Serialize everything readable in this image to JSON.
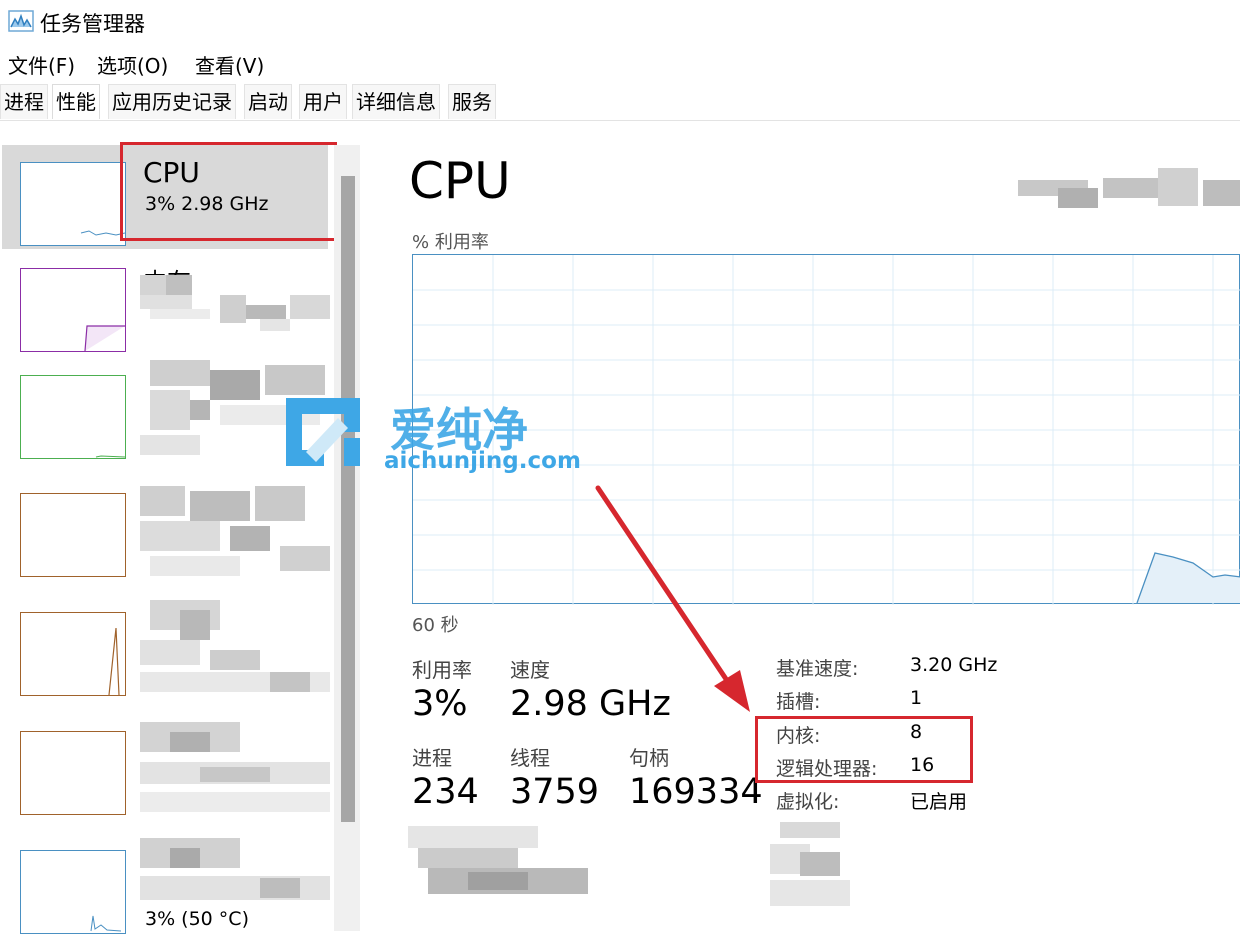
{
  "window": {
    "title": "任务管理器"
  },
  "menu": [
    "文件(F)",
    "选项(O)",
    "查看(V)"
  ],
  "tabs": [
    "进程",
    "性能",
    "应用历史记录",
    "启动",
    "用户",
    "详细信息",
    "服务"
  ],
  "sidebar": {
    "selected": {
      "title": "CPU",
      "subtitle": "3%  2.98 GHz"
    },
    "memory_title_partial": "内存",
    "last_item_subtitle": "3% (50 °C)"
  },
  "main": {
    "title": "CPU",
    "graph_top_label": "% 利用率",
    "graph_bottom_label": "60 秒",
    "stats": {
      "utilization_label": "利用率",
      "utilization_value": "3%",
      "speed_label": "速度",
      "speed_value": "2.98 GHz",
      "processes_label": "进程",
      "processes_value": "234",
      "threads_label": "线程",
      "threads_value": "3759",
      "handles_label": "句柄",
      "handles_value": "169334"
    },
    "specs": [
      {
        "label": "基准速度:",
        "value": "3.20 GHz"
      },
      {
        "label": "插槽:",
        "value": "1"
      },
      {
        "label": "内核:",
        "value": "8"
      },
      {
        "label": "逻辑处理器:",
        "value": "16"
      },
      {
        "label": "虚拟化:",
        "value": "已启用"
      }
    ]
  },
  "watermark": {
    "chinese": "爱纯净",
    "url": "aichunjing.com"
  },
  "colors": {
    "annotation_red": "#d6272e",
    "graph_blue": "#4a90c2",
    "watermark_blue": "#3ea7e6"
  }
}
